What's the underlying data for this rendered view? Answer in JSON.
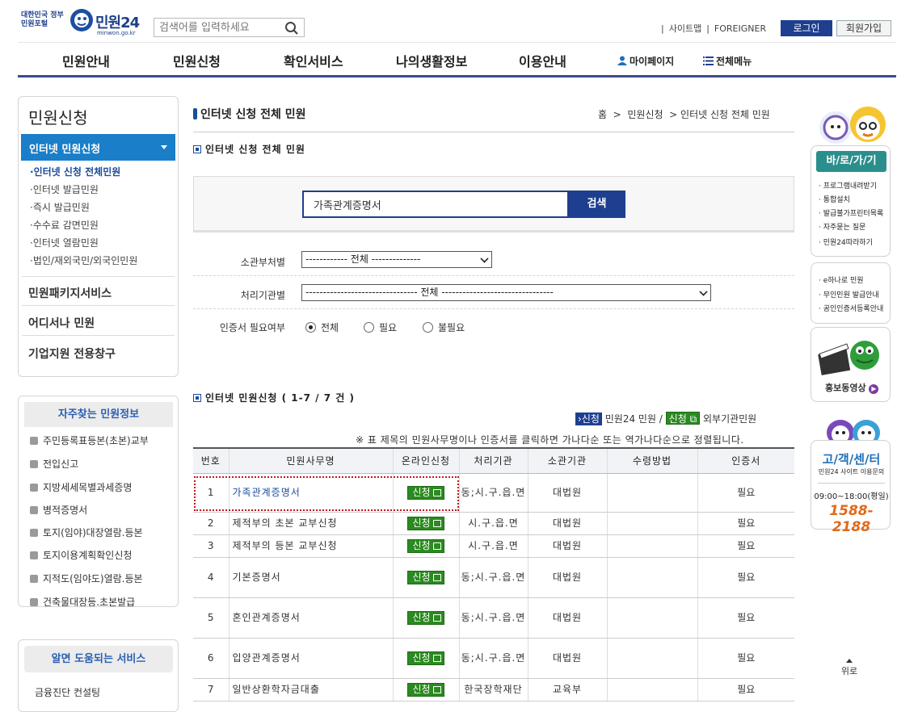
{
  "header": {
    "gov_portal": "대한민국 정부민원포털",
    "logo": "민원24",
    "logo_sub": "minwon.go.kr",
    "search_placeholder": "검색어를 입력하세요",
    "sitemap": "사이트맵",
    "foreigner": "FOREIGNER",
    "login": "로그인",
    "join": "회원가입"
  },
  "gnb": {
    "items": [
      "민원안내",
      "민원신청",
      "확인서비스",
      "나의생활정보",
      "이용안내"
    ],
    "mypage": "마이페이지",
    "allmenu": "전체메뉴"
  },
  "lnb": {
    "title": "민원신청",
    "active": "인터넷 민원신청",
    "subs": [
      "인터넷 신청 전체민원",
      "인터넷 발급민원",
      "즉시 발급민원",
      "수수료 감면민원",
      "인터넷 열람민원",
      "법인/재외국민/외국인민원"
    ],
    "mains": [
      "민원패키지서비스",
      "어디서나 민원",
      "기업지원 전용창구"
    ]
  },
  "freq": {
    "title": "자주찾는 민원정보",
    "items": [
      "주민등록표등본(초본)교부",
      "전입신고",
      "지방세세목별과세증명",
      "병적증명서",
      "토지(임야)대장열람.등본",
      "토지이용계획확인신청",
      "지적도(임야도)열람.등본",
      "건축물대장등.초본발급"
    ]
  },
  "help": {
    "title": "알면 도움되는 서비스",
    "item": "금융진단 컨설팅"
  },
  "main": {
    "page_title": "인터넷 신청 전체 민원",
    "breadcrumb": [
      "홈",
      "민원신청",
      "인터넷 신청 전체 민원"
    ],
    "section1": "인터넷 신청 전체 민원",
    "search_value": "가족관계증명서",
    "search_btn": "검색",
    "filter1_label": "소관부처별",
    "filter1_value": "------------ 전체 --------------",
    "filter2_label": "처리기관별",
    "filter2_value": "-------------------------------- 전체 --------------------------------",
    "filter3_label": "인증서 필요여부",
    "radios": [
      "전체",
      "필요",
      "불필요"
    ],
    "section2": "인터넷 민원신청 ( 1-7 / 7 건 )",
    "legend_blue": "신청",
    "legend_blue_text": "민원24 민원 /",
    "legend_green": "신청",
    "legend_green_text": "외부기관민원",
    "sort_note": "※ 표 제목의 민원사무명이나 인증서를 클릭하면 가나다순 또는 역가나다순으로 정렬됩니다.",
    "table": {
      "headers": [
        "번호",
        "민원사무명",
        "온라인신청",
        "처리기관",
        "소관기관",
        "수령방법",
        "인증서"
      ],
      "apply_label": "신청",
      "rows": [
        {
          "no": "1",
          "name": "가족관계증명서",
          "proc": "동;시.구.읍.면",
          "org": "대법원",
          "recv": "",
          "cert": "필요"
        },
        {
          "no": "2",
          "name": "제적부의 초본 교부신청",
          "proc": "시.구.읍.면",
          "org": "대법원",
          "recv": "",
          "cert": "필요"
        },
        {
          "no": "3",
          "name": "제적부의 등본 교부신청",
          "proc": "시.구.읍.면",
          "org": "대법원",
          "recv": "",
          "cert": "필요"
        },
        {
          "no": "4",
          "name": "기본증명서",
          "proc": "동;시.구.읍.면",
          "org": "대법원",
          "recv": "",
          "cert": "필요"
        },
        {
          "no": "5",
          "name": "혼인관계증명서",
          "proc": "동;시.구.읍.면",
          "org": "대법원",
          "recv": "",
          "cert": "필요"
        },
        {
          "no": "6",
          "name": "입양관계증명서",
          "proc": "동;시.구.읍.면",
          "org": "대법원",
          "recv": "",
          "cert": "필요"
        },
        {
          "no": "7",
          "name": "일반상환학자금대출",
          "proc": "한국장학재단",
          "org": "교육부",
          "recv": "",
          "cert": "필요"
        }
      ]
    }
  },
  "quick": {
    "title": "바/로/가/기",
    "links": [
      "프로그램내려받기",
      "통합설치",
      "발급불가프린터목록",
      "자주묻는 질문",
      "민원24따라하기"
    ],
    "links2": [
      "e하나로 민원",
      "무인민원 발급안내",
      "공인인증서등록안내"
    ],
    "promo": "홍보동영상",
    "cs_title": "고/객/센/터",
    "cs_sub": "민원24 사이트 이용문의",
    "cs_hours": "09:00~18:00(평일)",
    "cs_phone": "1588-2188",
    "top": "위로"
  }
}
